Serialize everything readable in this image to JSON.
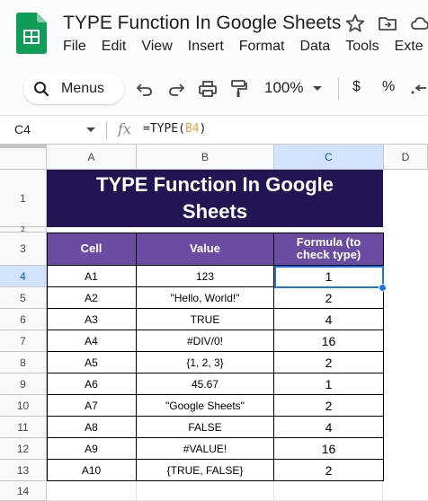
{
  "app": {
    "doc_title": "TYPE Function In Google Sheets",
    "menu": [
      "File",
      "Edit",
      "View",
      "Insert",
      "Format",
      "Data",
      "Tools",
      "Exte"
    ]
  },
  "toolbar": {
    "menus_label": "Menus",
    "zoom": "100%",
    "currency": "$",
    "percent": "%",
    "icons": [
      "search-icon",
      "undo-icon",
      "redo-icon",
      "print-icon",
      "paint-format-icon",
      "decimal-decrease-icon"
    ]
  },
  "formula_bar": {
    "cell_ref": "C4",
    "fx": "fx",
    "formula_prefix": "=TYPE(",
    "formula_ref": "B4",
    "formula_suffix": ")"
  },
  "grid": {
    "columns": [
      "A",
      "B",
      "C",
      "D"
    ],
    "selected_column": "C",
    "rows": [
      "1",
      "2",
      "3",
      "4",
      "5",
      "6",
      "7",
      "8",
      "9",
      "10",
      "11",
      "12",
      "13",
      "14"
    ],
    "selected_row": "4",
    "title_line1": "TYPE Function In Google",
    "title_line2": "Sheets",
    "headers": {
      "cell": "Cell",
      "value": "Value",
      "formula": "Formula (to check type)"
    },
    "data": [
      {
        "cell": "A1",
        "value": "123",
        "type": "1"
      },
      {
        "cell": "A2",
        "value": "\"Hello, World!\"",
        "type": "2"
      },
      {
        "cell": "A3",
        "value": "TRUE",
        "type": "4"
      },
      {
        "cell": "A4",
        "value": "#DIV/0!",
        "type": "16"
      },
      {
        "cell": "A5",
        "value": "{1, 2, 3}",
        "type": "2"
      },
      {
        "cell": "A6",
        "value": "45.67",
        "type": "1"
      },
      {
        "cell": "A7",
        "value": "\"Google Sheets\"",
        "type": "2"
      },
      {
        "cell": "A8",
        "value": "FALSE",
        "type": "4"
      },
      {
        "cell": "A9",
        "value": "#VALUE!",
        "type": "16"
      },
      {
        "cell": "A10",
        "value": "{TRUE, FALSE}",
        "type": "2"
      }
    ]
  },
  "colors": {
    "title_bg": "#231553",
    "header_bg": "#6a4da3",
    "selection": "#1a73e8",
    "sheets_green": "#0f9d58"
  }
}
